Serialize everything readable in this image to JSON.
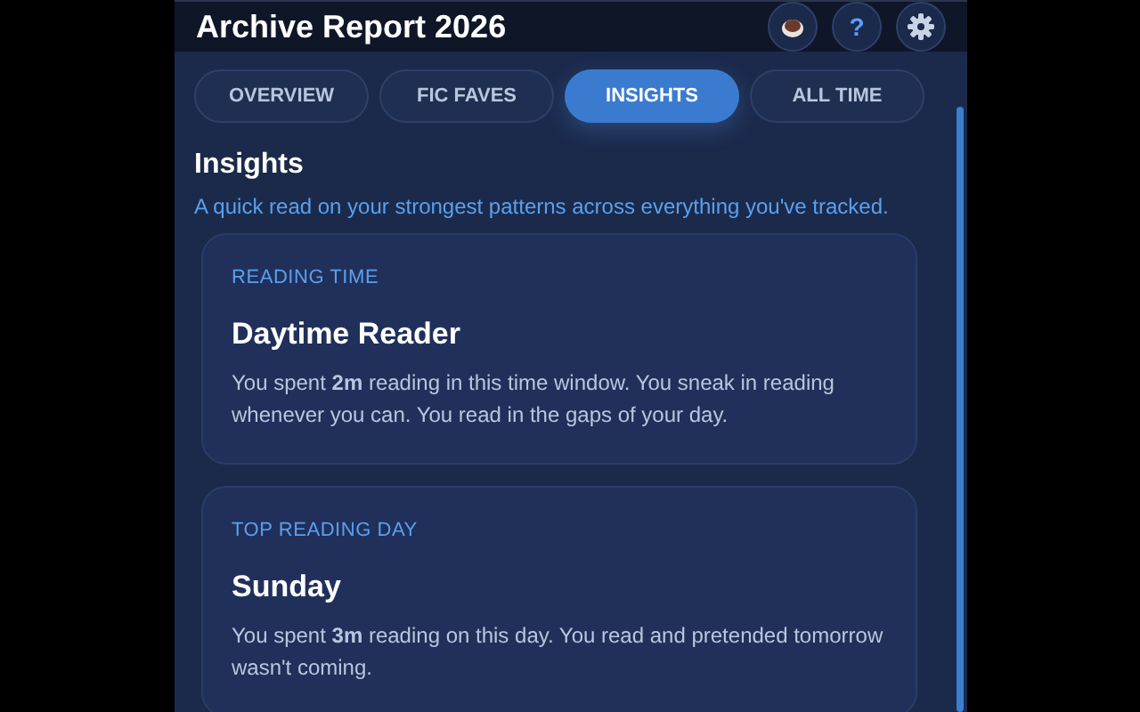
{
  "header": {
    "title": "Archive Report 2026",
    "help_label": "?"
  },
  "tabs": [
    {
      "label": "OVERVIEW",
      "selected": false
    },
    {
      "label": "FIC FAVES",
      "selected": false
    },
    {
      "label": "INSIGHTS",
      "selected": true
    },
    {
      "label": "ALL TIME",
      "selected": false
    }
  ],
  "section": {
    "title": "Insights",
    "subtitle": "A quick read on your strongest patterns across everything you've tracked."
  },
  "cards": [
    {
      "eyebrow": "READING TIME",
      "title": "Daytime Reader",
      "body": "You spent **2m** reading in this time window. You sneak in reading whenever you can. You read in the gaps of your day."
    },
    {
      "eyebrow": "TOP READING DAY",
      "title": "Sunday",
      "body": "You spent **3m** reading on this day. You read and pretended tomorrow wasn't coming."
    }
  ]
}
